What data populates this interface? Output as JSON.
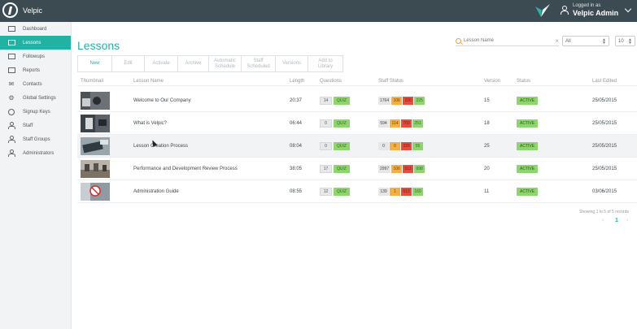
{
  "app": {
    "name": "Velpic"
  },
  "user": {
    "logged_label": "Logged in as",
    "name": "Velpic Admin"
  },
  "sidebar": {
    "items": [
      {
        "label": "Dashboard",
        "icon": "monitor-icon"
      },
      {
        "label": "Lessons",
        "icon": "screen-icon",
        "active": true
      },
      {
        "label": "Followups",
        "icon": "calendar-icon"
      },
      {
        "label": "Reports",
        "icon": "chart-icon"
      },
      {
        "label": "Contacts",
        "icon": "envelope-icon"
      },
      {
        "label": "Global Settings",
        "icon": "gear-icon"
      },
      {
        "label": "Signup Keys",
        "icon": "key-icon"
      },
      {
        "label": "Staff",
        "icon": "person-icon"
      },
      {
        "label": "Staff Groups",
        "icon": "people-icon"
      },
      {
        "label": "Administrators",
        "icon": "person-icon"
      }
    ]
  },
  "page": {
    "title": "Lessons"
  },
  "search": {
    "placeholder": "Lesson Name",
    "value": ""
  },
  "filters": {
    "status_value": "All",
    "per_page_value": "10"
  },
  "toolbar": {
    "buttons": [
      {
        "label": "New"
      },
      {
        "label": "Edit"
      },
      {
        "label": "Activate"
      },
      {
        "label": "Archive"
      },
      {
        "label": "Automatic\nSchedule"
      },
      {
        "label": "Staff\nScheduled"
      },
      {
        "label": "Versions"
      },
      {
        "label": "Add to\nLibrary"
      }
    ]
  },
  "table": {
    "headers": [
      "Thumbnail",
      "Lesson Name",
      "Length",
      "Questions",
      "Staff Status",
      "Version",
      "Status",
      "Last Edited"
    ],
    "quiz_label": "QUIZ",
    "rows": [
      {
        "name": "Welcome to Our Company",
        "length": "20:37",
        "questions": "14",
        "staff": [
          "1764",
          "106",
          "220",
          "225"
        ],
        "version": "15",
        "status": "ACTIVE",
        "edited": "25/05/2015"
      },
      {
        "name": "What is Velpic?",
        "length": "06:44",
        "questions": "0",
        "staff": [
          "594",
          "114",
          "760",
          "251"
        ],
        "version": "18",
        "status": "ACTIVE",
        "edited": "25/05/2015"
      },
      {
        "name": "Lesson Creation Process",
        "length": "08:04",
        "questions": "0",
        "staff": [
          "0",
          "0",
          "220",
          "55"
        ],
        "version": "25",
        "status": "ACTIVE",
        "edited": "25/05/2015"
      },
      {
        "name": "Performance and Development Review Process",
        "length": "38:05",
        "questions": "17",
        "staff": [
          "2997",
          "106",
          "513",
          "698"
        ],
        "version": "20",
        "status": "ACTIVE",
        "edited": "25/05/2015"
      },
      {
        "name": "Administration Guide",
        "length": "08:55",
        "questions": "12",
        "staff": [
          "139",
          "1",
          "513",
          "160"
        ],
        "version": "11",
        "status": "ACTIVE",
        "edited": "03/06/2015"
      }
    ]
  },
  "pagination": {
    "summary": "Showing 1 to 5 of 5 records",
    "prev": "‹",
    "current": "1",
    "next": "›"
  },
  "colors": {
    "accent": "#20b3a4",
    "topbar": "#3c4a52",
    "ok": "#8fd56e",
    "warn": "#f5b041",
    "danger": "#e74c3c"
  }
}
